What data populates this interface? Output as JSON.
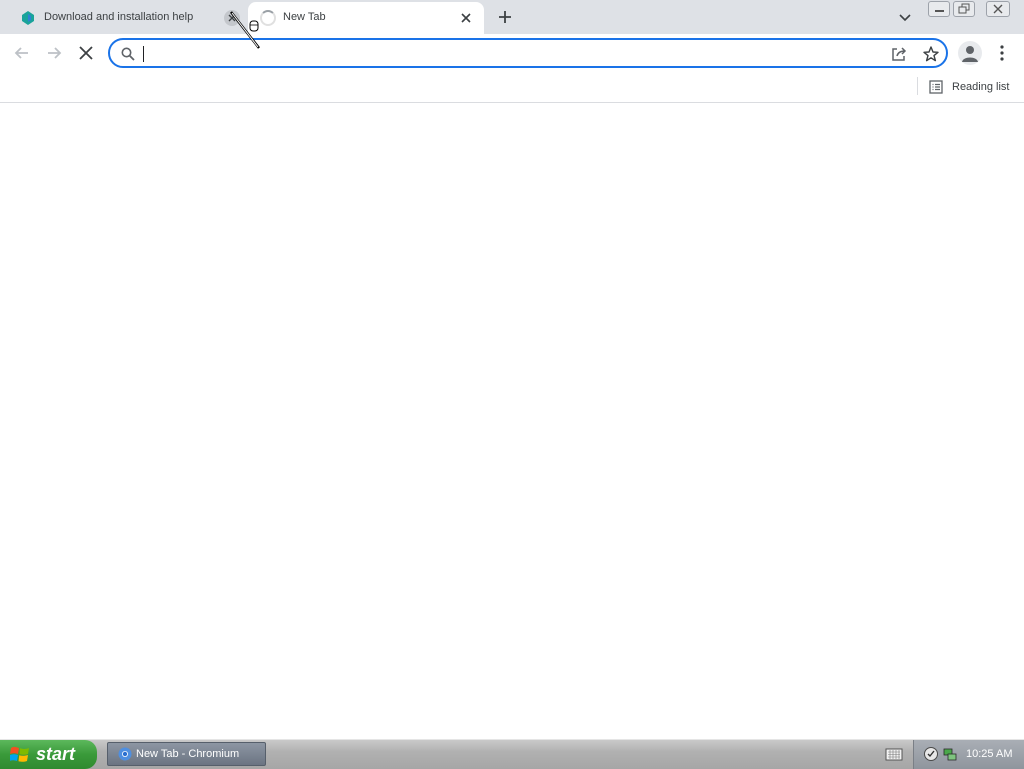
{
  "browser": {
    "tabs": [
      {
        "title": "Download and installation help",
        "state": "inactive",
        "favicon": "site-favicon"
      },
      {
        "title": "New Tab",
        "state": "active",
        "loading": true
      }
    ],
    "new_tab_icon": "plus-icon",
    "tab_search_icon": "chevron-down-icon",
    "window_controls": [
      "minimize",
      "restore",
      "close"
    ]
  },
  "toolbar": {
    "back_icon": "back-arrow-icon",
    "forward_icon": "forward-arrow-icon",
    "stop_icon": "stop-loading-icon",
    "omnibox": {
      "value": "",
      "placeholder": ""
    },
    "share_icon": "share-icon",
    "bookmark_icon": "star-icon",
    "profile_icon": "avatar-icon",
    "menu_icon": "kebab-menu-icon"
  },
  "bookmarks_bar": {
    "reading_list_label": "Reading list"
  },
  "taskbar": {
    "start_label": "start",
    "task_item_label": "New Tab - Chromium",
    "clock": "10:25 AM"
  },
  "colors": {
    "accent": "#1a73e8",
    "tabstrip_bg": "#dee1e6",
    "start_green": "#3a9a3a"
  }
}
